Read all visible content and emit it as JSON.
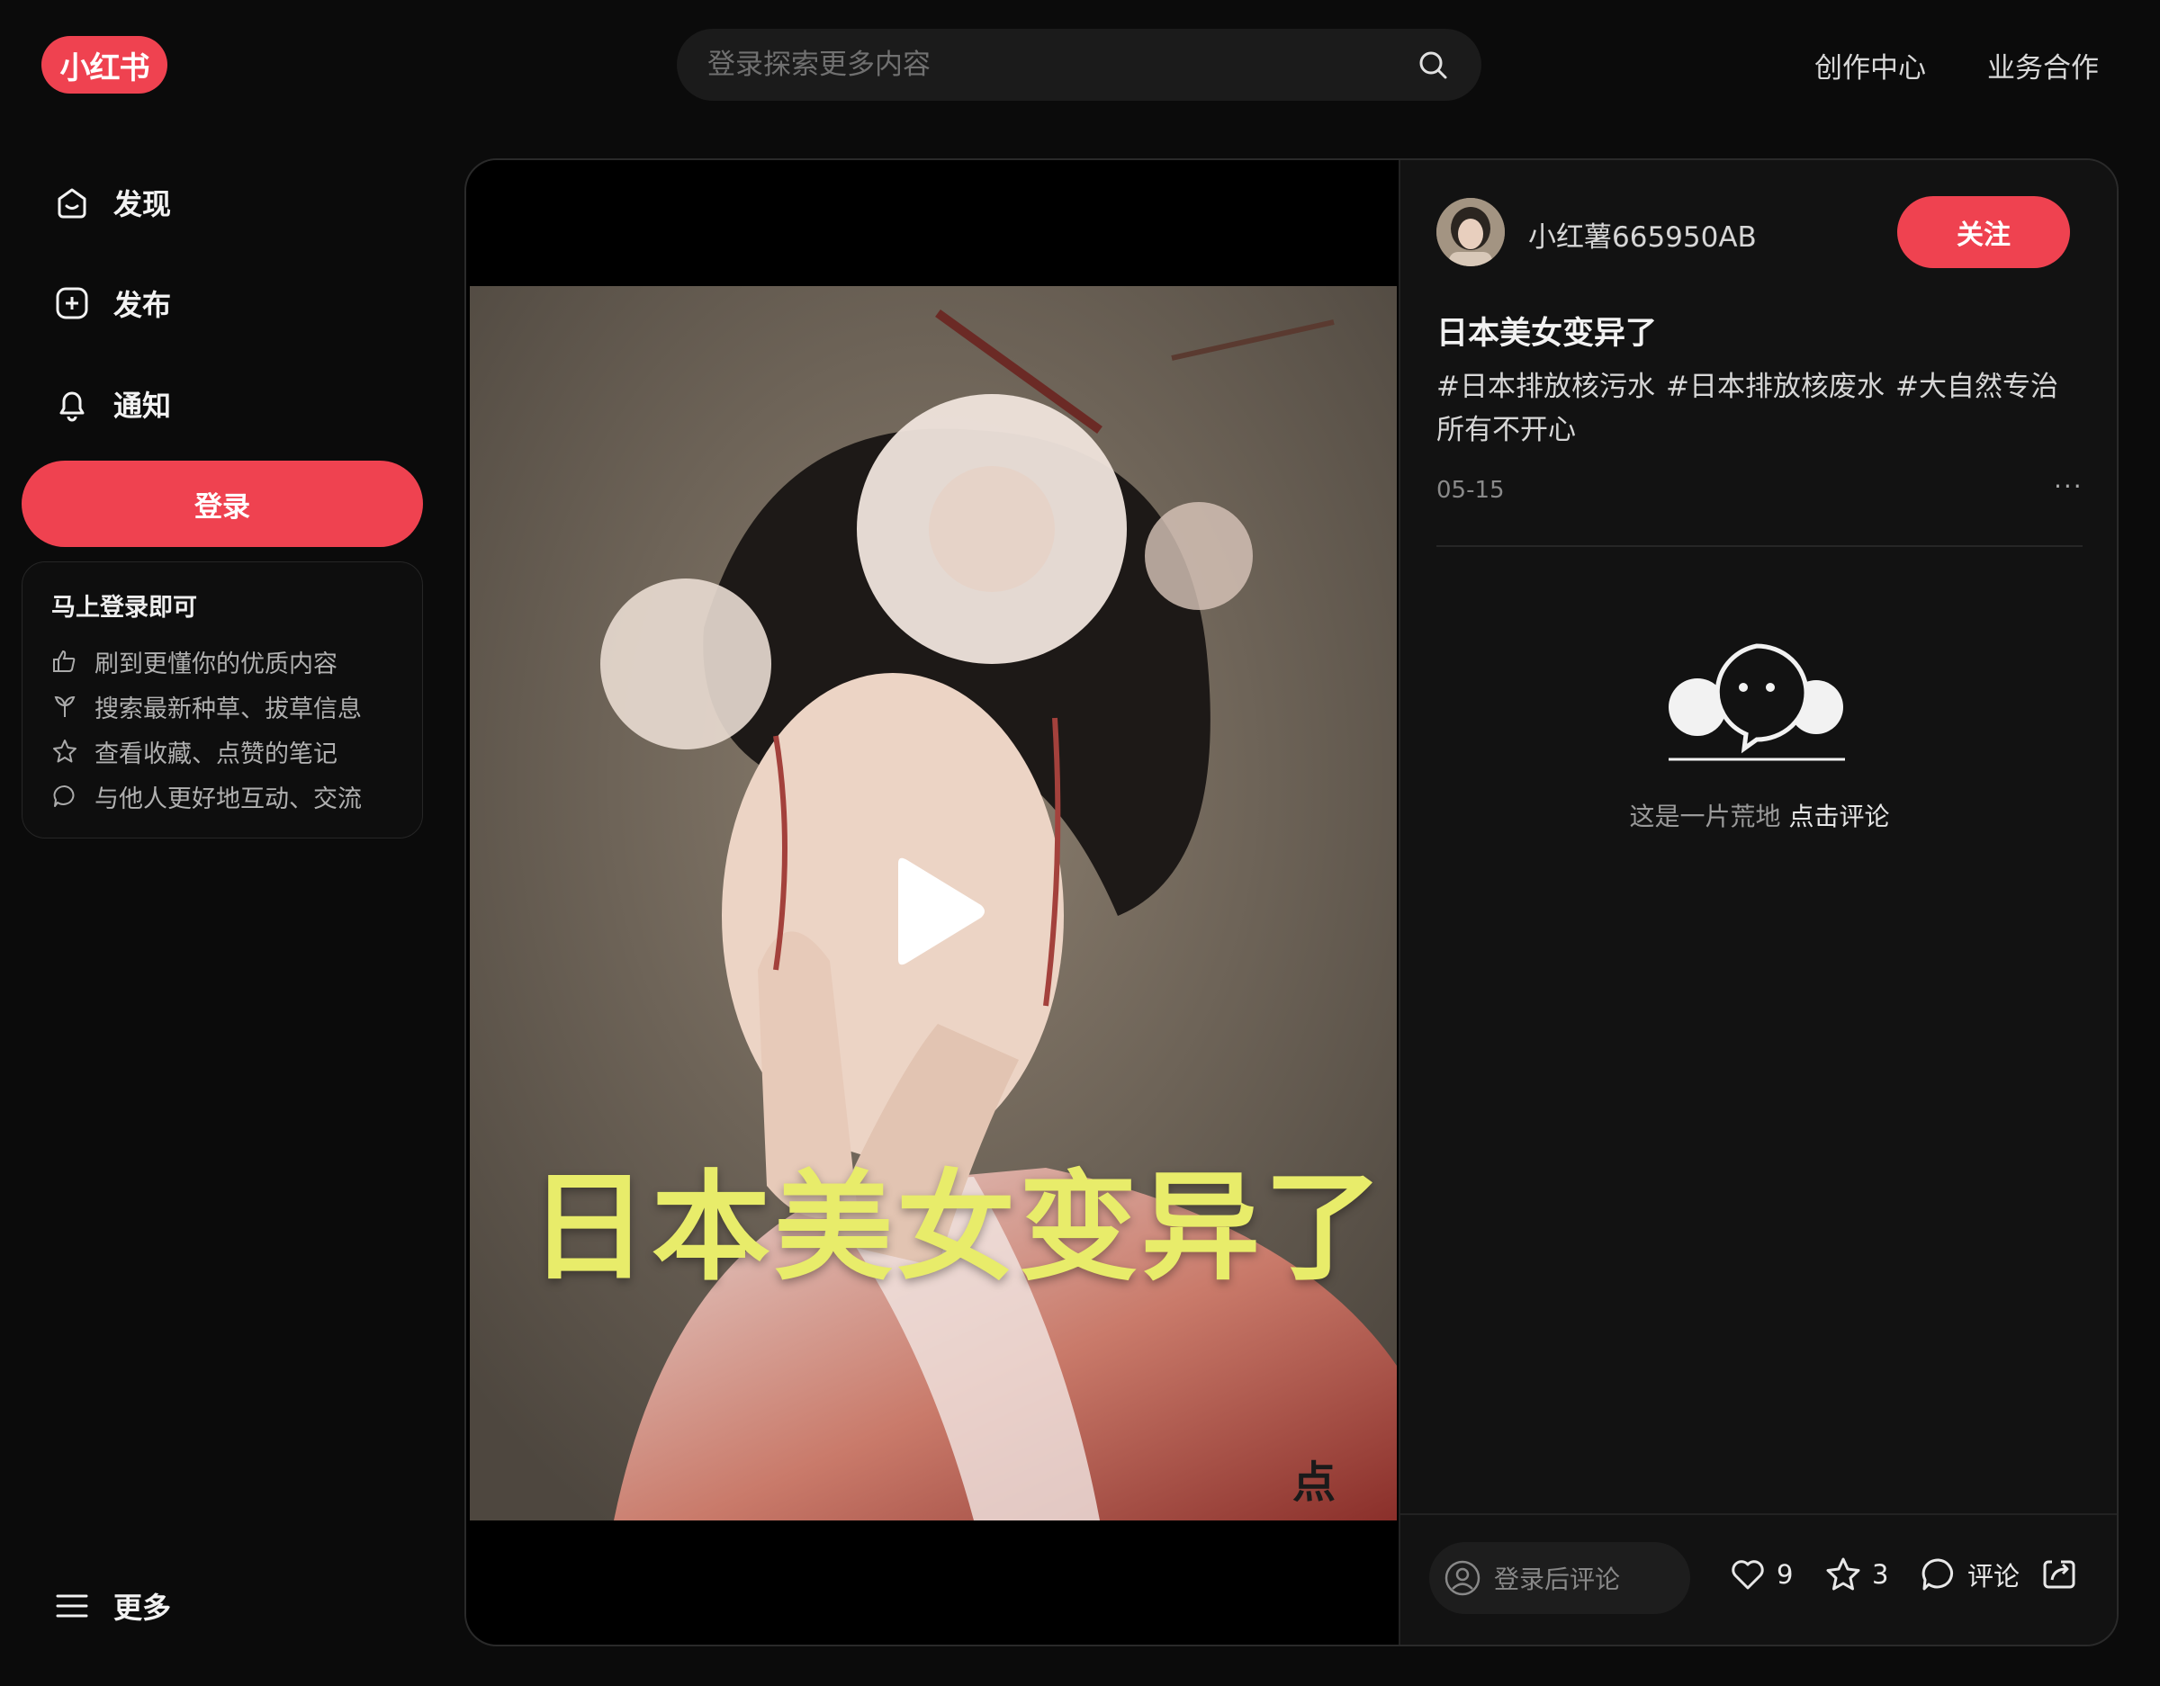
{
  "app": {
    "logo_text": "小红书",
    "brand_color": "#ef4250"
  },
  "header": {
    "search_placeholder": "登录探索更多内容",
    "links": [
      "创作中心",
      "业务合作"
    ]
  },
  "sidebar": {
    "items": [
      {
        "label": "发现",
        "icon": "home-icon"
      },
      {
        "label": "发布",
        "icon": "plus-square-icon"
      },
      {
        "label": "通知",
        "icon": "bell-icon"
      }
    ],
    "login_button": "登录",
    "login_card": {
      "title": "马上登录即可",
      "benefits": [
        {
          "text": "刷到更懂你的优质内容",
          "icon": "thumbs-up-icon"
        },
        {
          "text": "搜索最新种草、拔草信息",
          "icon": "sprout-icon"
        },
        {
          "text": "查看收藏、点赞的笔记",
          "icon": "star-icon"
        },
        {
          "text": "与他人更好地互动、交流",
          "icon": "chat-bubble-icon"
        }
      ]
    },
    "more_label": "更多"
  },
  "note": {
    "overlay_text": "日本美女变异了",
    "watermark_text": "点",
    "author": "小红薯665950AB",
    "follow_label": "关注",
    "title": "日本美女变异了",
    "tags": [
      "#日本排放核污水",
      "#日本排放核废水",
      "#大自然专治所有不开心"
    ],
    "date": "05-15",
    "more_menu": "···",
    "empty_comments": {
      "text": "这是一片荒地",
      "cta": "点击评论"
    },
    "comment_placeholder": "登录后评论",
    "likes": "9",
    "collects": "3",
    "comment_label": "评论"
  }
}
